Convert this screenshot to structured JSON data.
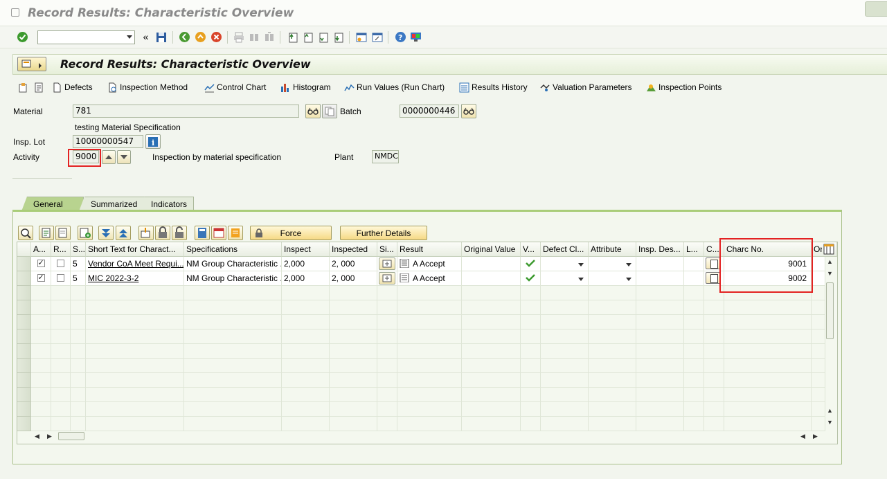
{
  "window": {
    "title": "Record Results: Characteristic Overview"
  },
  "toolbar": {
    "command_field": ""
  },
  "header": {
    "title": "Record Results: Characteristic Overview"
  },
  "app_toolbar": [
    {
      "label": "Defects",
      "icon": "document-icon"
    },
    {
      "label": "Inspection Method",
      "icon": "method-icon"
    },
    {
      "label": "Control Chart",
      "icon": "control-chart-icon"
    },
    {
      "label": "Histogram",
      "icon": "histogram-icon"
    },
    {
      "label": "Run Values (Run Chart)",
      "icon": "run-chart-icon"
    },
    {
      "label": "Results History",
      "icon": "results-history-icon"
    },
    {
      "label": "Valuation Parameters",
      "icon": "valuation-icon"
    },
    {
      "label": "Inspection Points",
      "icon": "inspection-points-icon"
    }
  ],
  "form": {
    "material_label": "Material",
    "material_value": "781",
    "material_desc": "testing Material Specification",
    "batch_label": "Batch",
    "batch_value": "0000000446",
    "insp_lot_label": "Insp. Lot",
    "insp_lot_value": "10000000547",
    "activity_label": "Activity",
    "activity_value": "9000",
    "activity_desc": "Inspection by material specification",
    "plant_label": "Plant",
    "plant_value": "NMDC"
  },
  "tabs": [
    "General",
    "Summarized",
    "Indicators"
  ],
  "grid_buttons": {
    "force": "Force",
    "further_details": "Further Details"
  },
  "grid": {
    "columns": [
      "A...",
      "R...",
      "S...",
      "Short Text for Charact...",
      "Specifications",
      "Inspect",
      "Inspected",
      "Si...",
      "Result",
      "Original Value",
      "V...",
      "Defect Cl...",
      "Attribute",
      "Insp. Des...",
      "L...",
      "C...",
      "Charc No.",
      "Ori"
    ],
    "rows": [
      {
        "a": true,
        "r": false,
        "s": "5",
        "short_text": "Vendor CoA Meet Requi...",
        "spec": "NM Group Characteristic ...",
        "inspect": "2,000",
        "inspected": "2, 000",
        "result": "A Accept",
        "charc_no": "9001"
      },
      {
        "a": true,
        "r": false,
        "s": "5",
        "short_text": "MIC 2022-3-2",
        "spec": "NM Group Characteristic ...",
        "inspect": "2,000",
        "inspected": "2, 000",
        "result": "A Accept",
        "charc_no": "9002"
      }
    ]
  },
  "colors": {
    "highlight": "#e32222",
    "accent": "#a9cd79"
  }
}
